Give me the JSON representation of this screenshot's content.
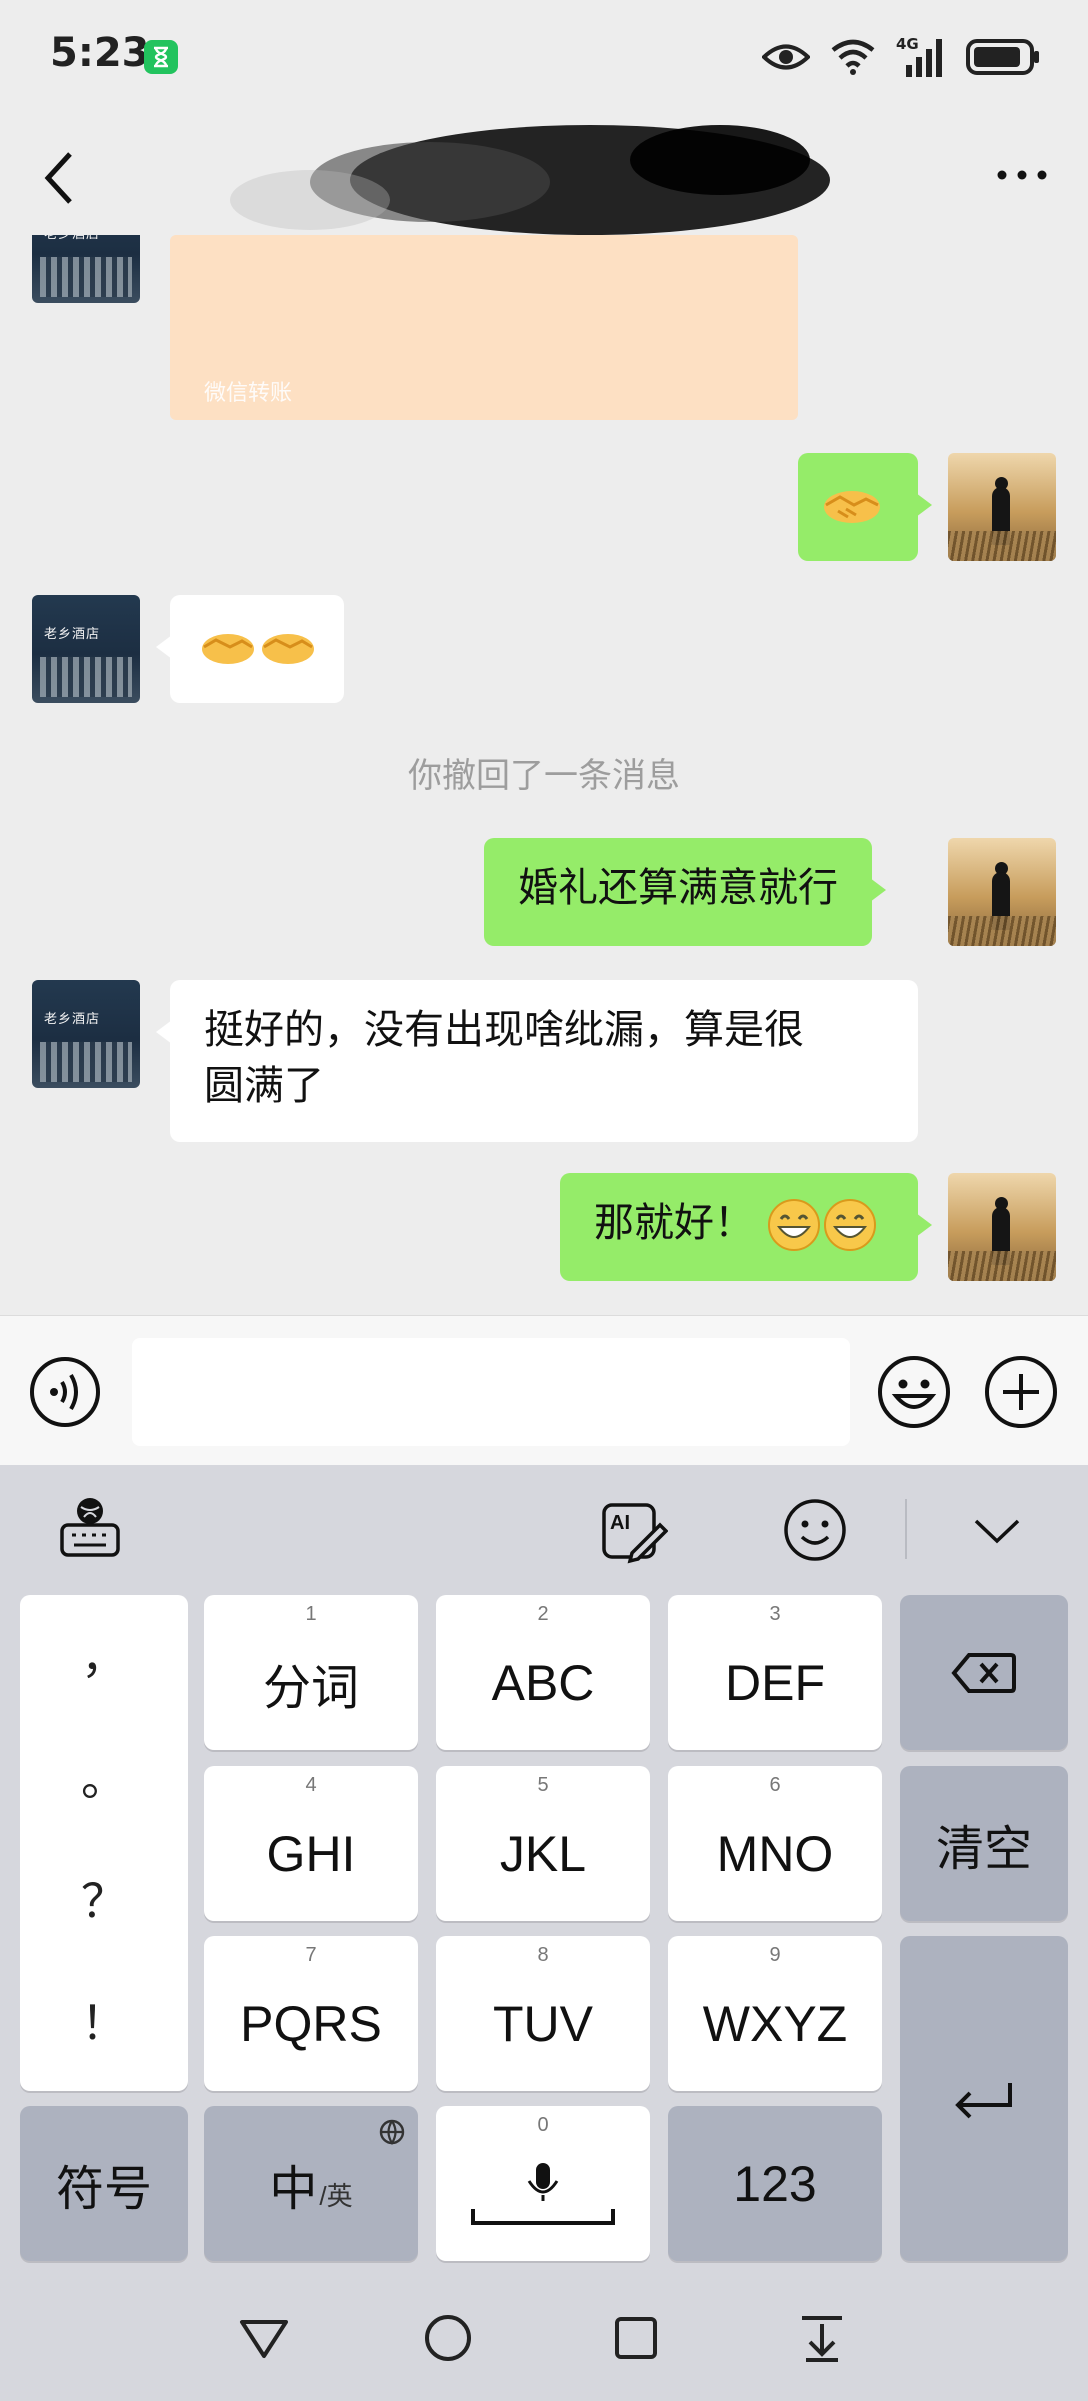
{
  "status_bar": {
    "time": "5:23",
    "network": "4G"
  },
  "nav": {
    "back_icon": "chevron-left-icon",
    "more_icon": "more-icon"
  },
  "chat": {
    "transfer_card": {
      "label": "微信转账"
    },
    "messages": [
      {
        "from": "me",
        "type": "emoji",
        "emoji": "handshake"
      },
      {
        "from": "contact",
        "type": "emoji",
        "emoji": "handshake x2"
      },
      {
        "from": "system",
        "text": "你撤回了一条消息"
      },
      {
        "from": "me",
        "text": "婚礼还算满意就行"
      },
      {
        "from": "contact",
        "text_line1": "挺好的，没有出现啥纰漏，算是很",
        "text_line2": "圆满了"
      },
      {
        "from": "me",
        "text": "那就好！",
        "trailing_emoji": "grin x2"
      }
    ],
    "contact_avatar_sign": "老乡酒店"
  },
  "input_bar": {
    "voice_icon": "voice-icon",
    "emoji_icon": "emoji-icon",
    "plus_icon": "plus-icon"
  },
  "keyboard": {
    "toolbar": [
      "keyboard-settings-icon",
      "ai-write-icon",
      "emoji-icon",
      "collapse-icon"
    ],
    "punctuation": [
      "，",
      "。",
      "？",
      "！"
    ],
    "keys": [
      {
        "num": "1",
        "label": "分词"
      },
      {
        "num": "2",
        "label": "ABC"
      },
      {
        "num": "3",
        "label": "DEF"
      },
      {
        "num": "4",
        "label": "GHI"
      },
      {
        "num": "5",
        "label": "JKL"
      },
      {
        "num": "6",
        "label": "MNO"
      },
      {
        "num": "7",
        "label": "PQRS"
      },
      {
        "num": "8",
        "label": "TUV"
      },
      {
        "num": "9",
        "label": "WXYZ"
      }
    ],
    "clear_label": "清空",
    "symbols_label": "符号",
    "lang_main": "中",
    "lang_sub": "/英",
    "space_num": "0",
    "numbers_label": "123"
  },
  "colors": {
    "chat_bg": "#ededed",
    "my_bubble": "#95ec69",
    "contact_bubble": "#ffffff",
    "system_text": "#9d9d9d",
    "keyboard_bg": "#d6d7dd",
    "dark_key": "#adb2bf"
  }
}
